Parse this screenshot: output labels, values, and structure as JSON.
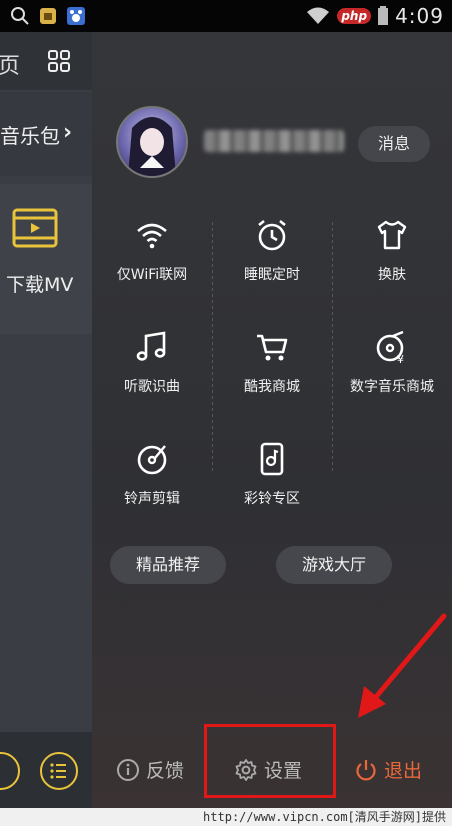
{
  "status_bar": {
    "time": "4:09",
    "badge": "php"
  },
  "background_page": {
    "top_fragment": "页",
    "music_pack": "音乐包",
    "download_mv": "下载MV"
  },
  "profile": {
    "message_button": "消息"
  },
  "menu": [
    {
      "label": "仅WiFi联网",
      "icon": "wifi-icon"
    },
    {
      "label": "睡眠定时",
      "icon": "alarm-clock-icon"
    },
    {
      "label": "换肤",
      "icon": "tshirt-icon"
    },
    {
      "label": "听歌识曲",
      "icon": "music-note-icon"
    },
    {
      "label": "酷我商城",
      "icon": "shopping-cart-icon"
    },
    {
      "label": "数字音乐商城",
      "icon": "digital-music-icon"
    },
    {
      "label": "铃声剪辑",
      "icon": "ringtone-disc-icon"
    },
    {
      "label": "彩铃专区",
      "icon": "phone-music-icon"
    }
  ],
  "pills": {
    "recommend": "精品推荐",
    "games": "游戏大厅"
  },
  "bottom": {
    "feedback": "反馈",
    "settings": "设置",
    "exit": "退出"
  },
  "watermark": "http://www.vipcn.com[清风手游网]提供",
  "colors": {
    "accent_yellow": "#e9c33a",
    "highlight_red": "#e01818"
  }
}
